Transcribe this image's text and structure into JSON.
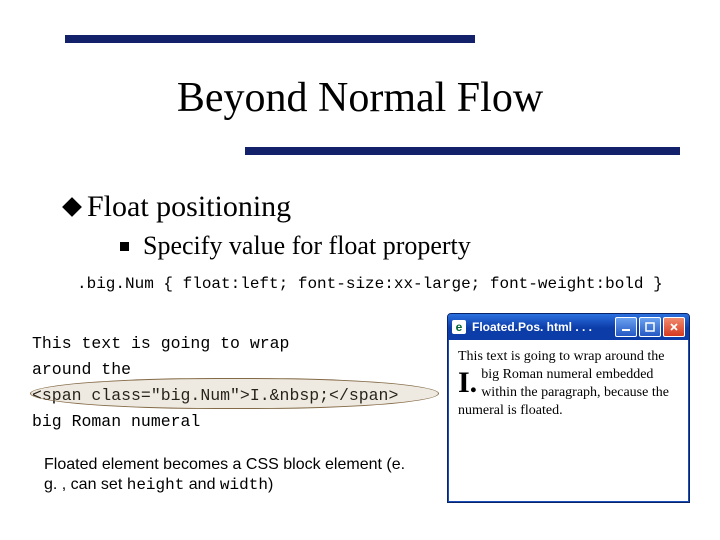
{
  "title": "Beyond Normal Flow",
  "bullets": {
    "item1": "Float positioning",
    "item2": "Specify value for float property"
  },
  "code": {
    "css_rule": ".big.Num { float:left; font-size:xx-large; font-weight:bold }",
    "src_line1": "This text is going to wrap",
    "src_line2": "around the",
    "src_line3": "<span class=\"big.Num\">I.&nbsp;</span>",
    "src_line4": "big Roman numeral"
  },
  "caption": {
    "part1": "Floated element becomes a CSS block element (e. g. , can set ",
    "mono1": "height",
    "and": " and ",
    "mono2": "width",
    "close": ")"
  },
  "browser": {
    "window_title": "Floated.Pos. html . . .",
    "favicon_glyph": "e",
    "body_intro": "This text is going to wrap around the big Roman numeral",
    "big_num": "I.",
    "body_rest": " embedded within the paragraph, because the numeral is floated."
  },
  "winbtns": {
    "min_alt": "Minimize",
    "max_alt": "Maximize",
    "close_alt": "Close"
  }
}
